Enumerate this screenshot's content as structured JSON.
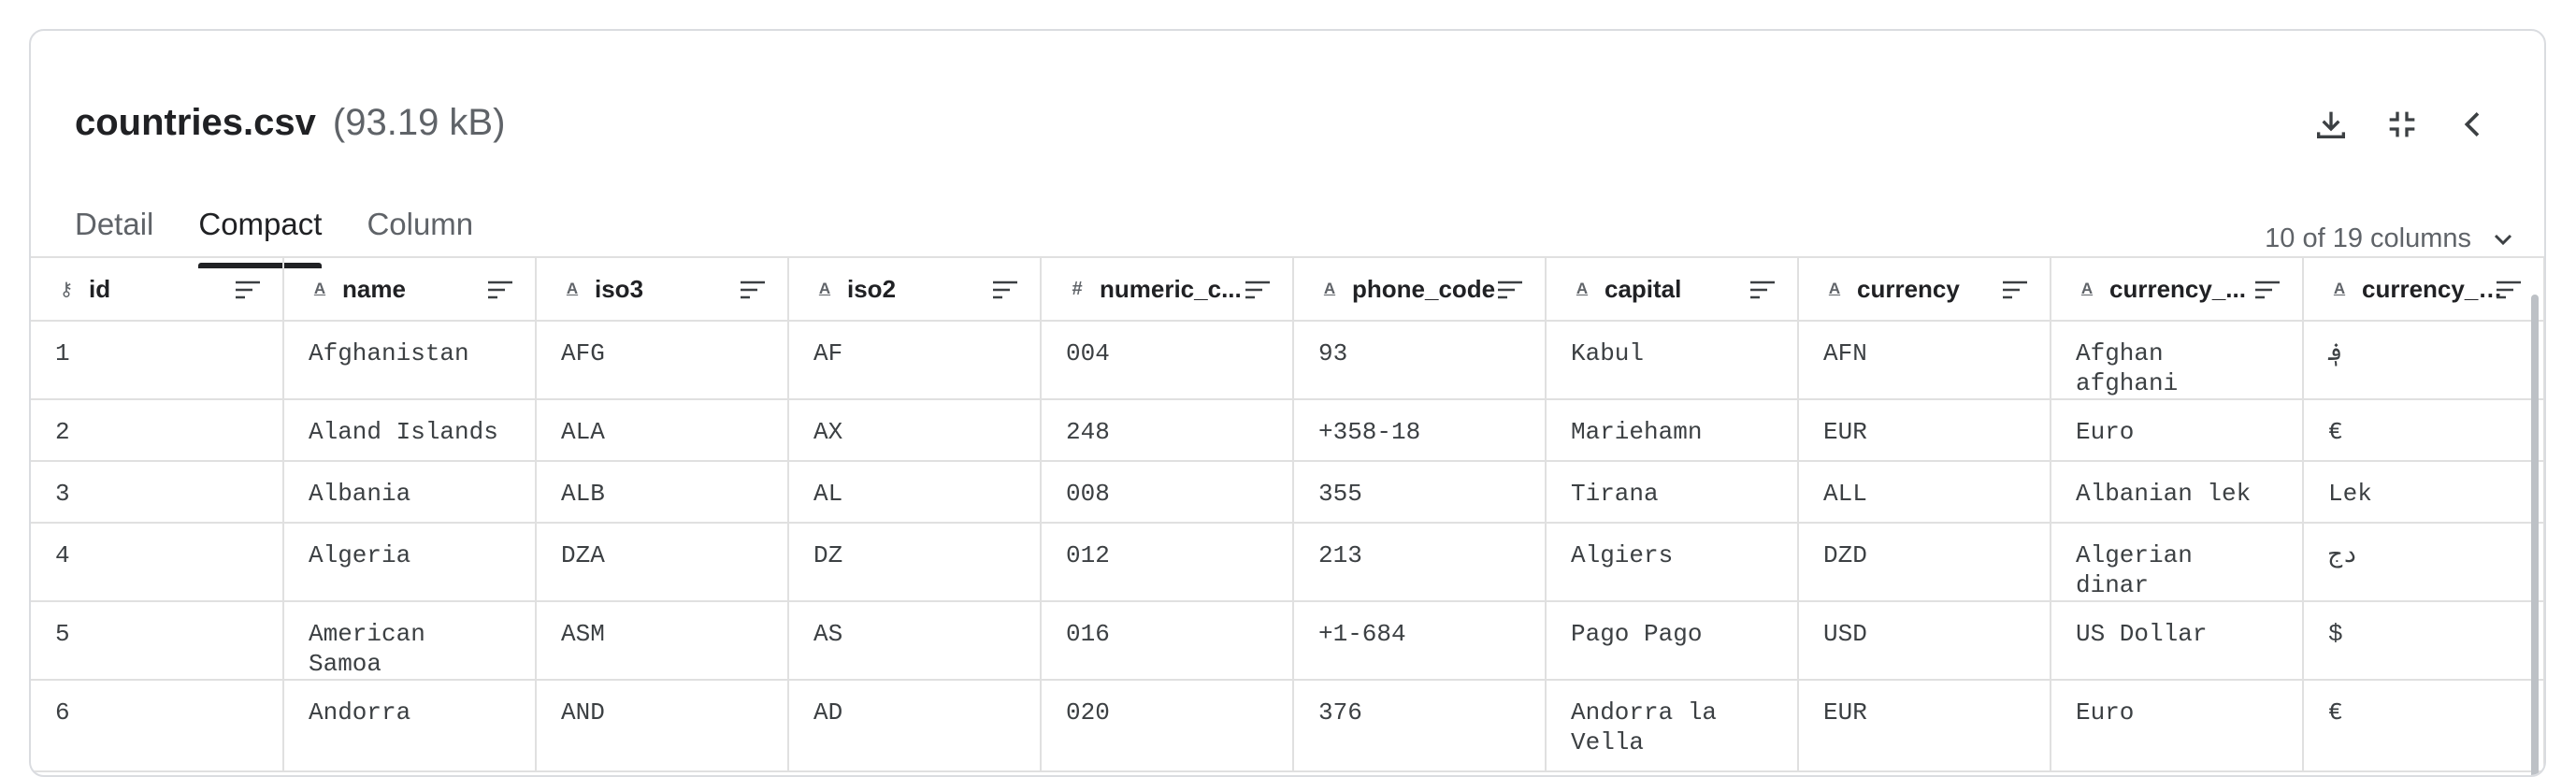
{
  "file": {
    "name": "countries.csv",
    "size": "(93.19 kB)"
  },
  "icons": {
    "download": "download-icon",
    "collapse": "fullscreen-exit-icon",
    "back": "chevron-left-icon"
  },
  "tabs": [
    "Detail",
    "Compact",
    "Column"
  ],
  "active_tab": "Compact",
  "column_count": "10 of 19 columns",
  "columns": [
    {
      "label": "id",
      "type": "key"
    },
    {
      "label": "name",
      "type": "string"
    },
    {
      "label": "iso3",
      "type": "string"
    },
    {
      "label": "iso2",
      "type": "string"
    },
    {
      "label": "numeric_c...",
      "type": "number"
    },
    {
      "label": "phone_code",
      "type": "string"
    },
    {
      "label": "capital",
      "type": "string"
    },
    {
      "label": "currency",
      "type": "string"
    },
    {
      "label": "currency_...",
      "type": "string"
    },
    {
      "label": "currency_s...",
      "type": "string"
    }
  ],
  "rows": [
    [
      "1",
      "Afghanistan",
      "AFG",
      "AF",
      "004",
      "93",
      "Kabul",
      "AFN",
      "Afghan afghani",
      "؋"
    ],
    [
      "2",
      "Aland Islands",
      "ALA",
      "AX",
      "248",
      "+358-18",
      "Mariehamn",
      "EUR",
      "Euro",
      "€"
    ],
    [
      "3",
      "Albania",
      "ALB",
      "AL",
      "008",
      "355",
      "Tirana",
      "ALL",
      "Albanian lek",
      "Lek"
    ],
    [
      "4",
      "Algeria",
      "DZA",
      "DZ",
      "012",
      "213",
      "Algiers",
      "DZD",
      "Algerian dinar",
      "دج"
    ],
    [
      "5",
      "American Samoa",
      "ASM",
      "AS",
      "016",
      "+1-684",
      "Pago Pago",
      "USD",
      "US Dollar",
      "$"
    ],
    [
      "6",
      "Andorra",
      "AND",
      "AD",
      "020",
      "376",
      "Andorra la Vella",
      "EUR",
      "Euro",
      "€"
    ]
  ]
}
